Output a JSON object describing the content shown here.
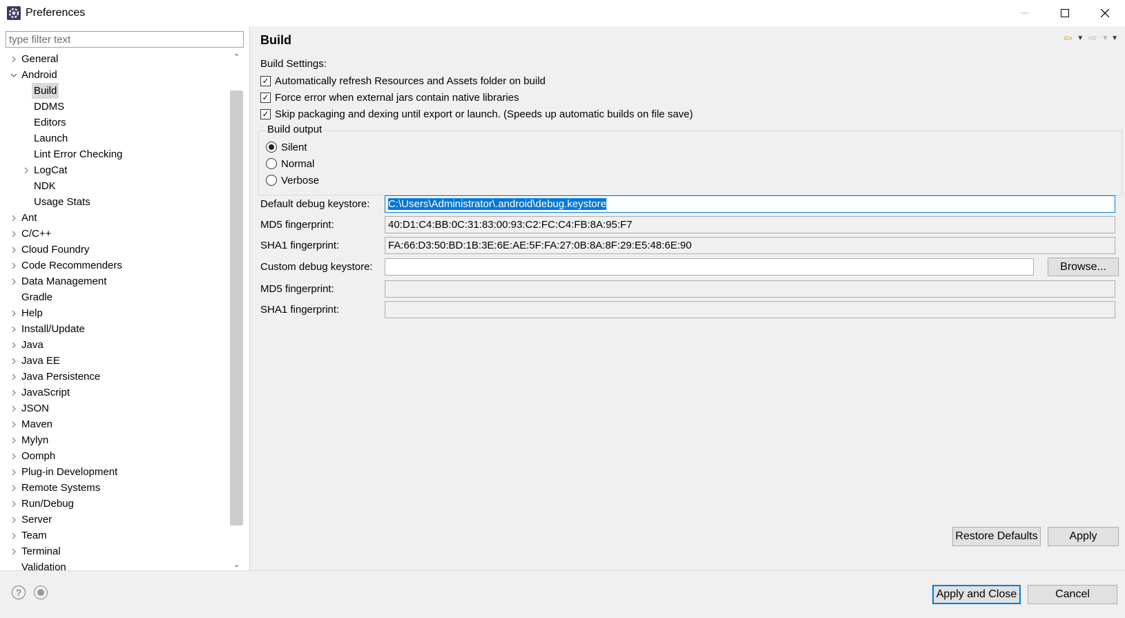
{
  "window": {
    "title": "Preferences",
    "app_icon": "eclipse-gear-icon",
    "controls": {
      "minimize_icon": "minimize-icon",
      "maximize_icon": "maximize-icon",
      "close_icon": "close-icon"
    }
  },
  "sidebar": {
    "filter_placeholder": "type filter text",
    "filter_value": "",
    "tree": [
      {
        "label": "General",
        "level": 0,
        "expandable": true,
        "expanded": false
      },
      {
        "label": "Android",
        "level": 0,
        "expandable": true,
        "expanded": true
      },
      {
        "label": "Build",
        "level": 1,
        "expandable": false,
        "selected": true
      },
      {
        "label": "DDMS",
        "level": 1,
        "expandable": false
      },
      {
        "label": "Editors",
        "level": 1,
        "expandable": false
      },
      {
        "label": "Launch",
        "level": 1,
        "expandable": false
      },
      {
        "label": "Lint Error Checking",
        "level": 1,
        "expandable": false
      },
      {
        "label": "LogCat",
        "level": 1,
        "expandable": true,
        "expanded": false
      },
      {
        "label": "NDK",
        "level": 1,
        "expandable": false
      },
      {
        "label": "Usage Stats",
        "level": 1,
        "expandable": false
      },
      {
        "label": "Ant",
        "level": 0,
        "expandable": true
      },
      {
        "label": "C/C++",
        "level": 0,
        "expandable": true
      },
      {
        "label": "Cloud Foundry",
        "level": 0,
        "expandable": true
      },
      {
        "label": "Code Recommenders",
        "level": 0,
        "expandable": true
      },
      {
        "label": "Data Management",
        "level": 0,
        "expandable": true
      },
      {
        "label": "Gradle",
        "level": 0,
        "expandable": false
      },
      {
        "label": "Help",
        "level": 0,
        "expandable": true
      },
      {
        "label": "Install/Update",
        "level": 0,
        "expandable": true
      },
      {
        "label": "Java",
        "level": 0,
        "expandable": true
      },
      {
        "label": "Java EE",
        "level": 0,
        "expandable": true
      },
      {
        "label": "Java Persistence",
        "level": 0,
        "expandable": true
      },
      {
        "label": "JavaScript",
        "level": 0,
        "expandable": true
      },
      {
        "label": "JSON",
        "level": 0,
        "expandable": true
      },
      {
        "label": "Maven",
        "level": 0,
        "expandable": true
      },
      {
        "label": "Mylyn",
        "level": 0,
        "expandable": true
      },
      {
        "label": "Oomph",
        "level": 0,
        "expandable": true
      },
      {
        "label": "Plug-in Development",
        "level": 0,
        "expandable": true
      },
      {
        "label": "Remote Systems",
        "level": 0,
        "expandable": true
      },
      {
        "label": "Run/Debug",
        "level": 0,
        "expandable": true
      },
      {
        "label": "Server",
        "level": 0,
        "expandable": true
      },
      {
        "label": "Team",
        "level": 0,
        "expandable": true
      },
      {
        "label": "Terminal",
        "level": 0,
        "expandable": true
      },
      {
        "label": "Validation",
        "level": 0,
        "expandable": false
      }
    ]
  },
  "page": {
    "title": "Build",
    "settings_label": "Build Settings:",
    "checkboxes": [
      {
        "label": "Automatically refresh Resources and Assets folder on build",
        "checked": true
      },
      {
        "label": "Force error when external jars contain native libraries",
        "checked": true
      },
      {
        "label": "Skip packaging and dexing until export or launch. (Speeds up automatic builds on file save)",
        "checked": true
      }
    ],
    "build_output": {
      "title": "Build output",
      "options": [
        {
          "label": "Silent",
          "selected": true
        },
        {
          "label": "Normal",
          "selected": false
        },
        {
          "label": "Verbose",
          "selected": false
        }
      ]
    },
    "default_keystore": {
      "label": "Default debug keystore:",
      "value": "C:\\Users\\Administrator\\.android\\debug.keystore"
    },
    "md5_label": "MD5 fingerprint:",
    "md5_value": "40:D1:C4:BB:0C:31:83:00:93:C2:FC:C4:FB:8A:95:F7",
    "sha1_label": "SHA1 fingerprint:",
    "sha1_value": "FA:66:D3:50:BD:1B:3E:6E:AE:5F:FA:27:0B:8A:8F:29:E5:48:6E:90",
    "custom_keystore": {
      "label": "Custom debug keystore:",
      "value": "",
      "browse_label": "Browse..."
    },
    "custom_md5_label": "MD5 fingerprint:",
    "custom_md5_value": "",
    "custom_sha1_label": "SHA1 fingerprint:",
    "custom_sha1_value": "",
    "restore_defaults_label": "Restore Defaults",
    "apply_label": "Apply"
  },
  "footer": {
    "help_icon": "help-icon",
    "record_icon": "record-icon",
    "apply_close_label": "Apply and Close",
    "cancel_label": "Cancel"
  },
  "colors": {
    "selection": "#0078d7",
    "panel_bg": "#f0f0f0",
    "nav_back": "#d7a31e"
  }
}
